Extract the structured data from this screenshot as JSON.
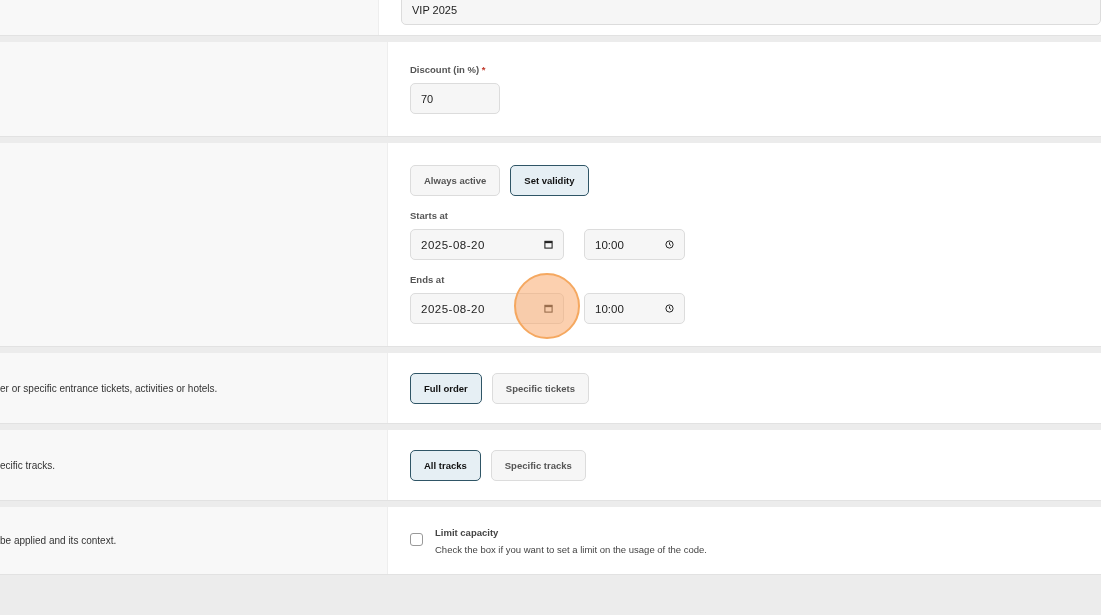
{
  "name_field": {
    "value": "VIP 2025"
  },
  "discount": {
    "label": "Discount (in %)",
    "required_mark": "*",
    "value": "70"
  },
  "validity": {
    "options": [
      {
        "label": "Always active",
        "selected": false
      },
      {
        "label": "Set validity",
        "selected": true
      }
    ],
    "starts": {
      "label": "Starts at",
      "date": "2025-08-20",
      "time": "10:00"
    },
    "ends": {
      "label": "Ends at",
      "date": "2025-08-20",
      "time": "10:00"
    }
  },
  "applies_to": {
    "description": "er or specific entrance tickets, activities or hotels.",
    "options": [
      {
        "label": "Full order",
        "selected": true
      },
      {
        "label": "Specific tickets",
        "selected": false
      }
    ]
  },
  "tracks": {
    "description": "ecific tracks.",
    "options": [
      {
        "label": "All tracks",
        "selected": true
      },
      {
        "label": "Specific tracks",
        "selected": false
      }
    ]
  },
  "capacity": {
    "description": "be applied and its context.",
    "checked": false,
    "label": "Limit capacity",
    "hint": "Check the box if you want to set a limit on the usage of the code."
  },
  "click_highlight": true
}
